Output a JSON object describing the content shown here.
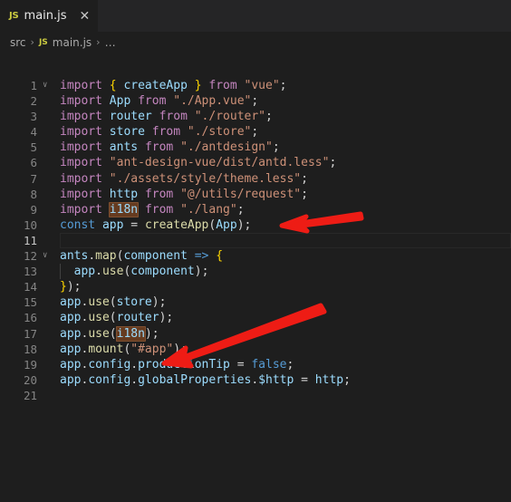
{
  "window": {
    "background": "#1e1e1e",
    "editor_background": "#1e1e1e",
    "tabbar_background": "#252526"
  },
  "tabbar": {
    "tabs": [
      {
        "icon": "js-file-icon",
        "icon_label": "JS",
        "label": "main.js",
        "close_label": "✕",
        "active": true
      }
    ]
  },
  "breadcrumb": {
    "separator": "›",
    "items": [
      {
        "label": "src",
        "icon": null
      },
      {
        "label": "main.js",
        "icon": "js-file-icon",
        "icon_label": "JS"
      },
      {
        "label": "…",
        "icon": null
      }
    ]
  },
  "editor": {
    "active_line": 11,
    "fold_lines": [
      1,
      12
    ],
    "highlight_color": "#653b20",
    "highlight_border_color": "#7f5030",
    "total_lines": 21,
    "lines": [
      {
        "n": "1",
        "tokens": [
          {
            "t": "import",
            "c": "t-kw"
          },
          {
            "t": " ",
            "c": "t-punct"
          },
          {
            "t": "{",
            "c": "t-brace"
          },
          {
            "t": " ",
            "c": "t-punct"
          },
          {
            "t": "createApp",
            "c": "t-var"
          },
          {
            "t": " ",
            "c": "t-punct"
          },
          {
            "t": "}",
            "c": "t-brace"
          },
          {
            "t": " ",
            "c": "t-punct"
          },
          {
            "t": "from",
            "c": "t-kw"
          },
          {
            "t": " ",
            "c": "t-punct"
          },
          {
            "t": "\"vue\"",
            "c": "t-str"
          },
          {
            "t": ";",
            "c": "t-punct"
          }
        ]
      },
      {
        "n": "2",
        "tokens": [
          {
            "t": "import",
            "c": "t-kw"
          },
          {
            "t": " ",
            "c": "t-punct"
          },
          {
            "t": "App",
            "c": "t-var"
          },
          {
            "t": " ",
            "c": "t-punct"
          },
          {
            "t": "from",
            "c": "t-kw"
          },
          {
            "t": " ",
            "c": "t-punct"
          },
          {
            "t": "\"./App.vue\"",
            "c": "t-str"
          },
          {
            "t": ";",
            "c": "t-punct"
          }
        ]
      },
      {
        "n": "3",
        "tokens": [
          {
            "t": "import",
            "c": "t-kw"
          },
          {
            "t": " ",
            "c": "t-punct"
          },
          {
            "t": "router",
            "c": "t-var"
          },
          {
            "t": " ",
            "c": "t-punct"
          },
          {
            "t": "from",
            "c": "t-kw"
          },
          {
            "t": " ",
            "c": "t-punct"
          },
          {
            "t": "\"./router\"",
            "c": "t-str"
          },
          {
            "t": ";",
            "c": "t-punct"
          }
        ]
      },
      {
        "n": "4",
        "tokens": [
          {
            "t": "import",
            "c": "t-kw"
          },
          {
            "t": " ",
            "c": "t-punct"
          },
          {
            "t": "store",
            "c": "t-var"
          },
          {
            "t": " ",
            "c": "t-punct"
          },
          {
            "t": "from",
            "c": "t-kw"
          },
          {
            "t": " ",
            "c": "t-punct"
          },
          {
            "t": "\"./store\"",
            "c": "t-str"
          },
          {
            "t": ";",
            "c": "t-punct"
          }
        ]
      },
      {
        "n": "5",
        "tokens": [
          {
            "t": "import",
            "c": "t-kw"
          },
          {
            "t": " ",
            "c": "t-punct"
          },
          {
            "t": "ants",
            "c": "t-var"
          },
          {
            "t": " ",
            "c": "t-punct"
          },
          {
            "t": "from",
            "c": "t-kw"
          },
          {
            "t": " ",
            "c": "t-punct"
          },
          {
            "t": "\"./antdesign\"",
            "c": "t-str"
          },
          {
            "t": ";",
            "c": "t-punct"
          }
        ]
      },
      {
        "n": "6",
        "tokens": [
          {
            "t": "import",
            "c": "t-kw"
          },
          {
            "t": " ",
            "c": "t-punct"
          },
          {
            "t": "\"ant-design-vue/dist/antd.less\"",
            "c": "t-str"
          },
          {
            "t": ";",
            "c": "t-punct"
          }
        ]
      },
      {
        "n": "7",
        "tokens": [
          {
            "t": "import",
            "c": "t-kw"
          },
          {
            "t": " ",
            "c": "t-punct"
          },
          {
            "t": "\"./assets/style/theme.less\"",
            "c": "t-str"
          },
          {
            "t": ";",
            "c": "t-punct"
          }
        ]
      },
      {
        "n": "8",
        "tokens": [
          {
            "t": "import",
            "c": "t-kw"
          },
          {
            "t": " ",
            "c": "t-punct"
          },
          {
            "t": "http",
            "c": "t-var"
          },
          {
            "t": " ",
            "c": "t-punct"
          },
          {
            "t": "from",
            "c": "t-kw"
          },
          {
            "t": " ",
            "c": "t-punct"
          },
          {
            "t": "\"@/utils/request\"",
            "c": "t-str"
          },
          {
            "t": ";",
            "c": "t-punct"
          }
        ]
      },
      {
        "n": "9",
        "tokens": [
          {
            "t": "import",
            "c": "t-kw"
          },
          {
            "t": " ",
            "c": "t-punct"
          },
          {
            "t": "i18n",
            "c": "t-var",
            "sel": true
          },
          {
            "t": " ",
            "c": "t-punct"
          },
          {
            "t": "from",
            "c": "t-kw"
          },
          {
            "t": " ",
            "c": "t-punct"
          },
          {
            "t": "\"./lang\"",
            "c": "t-str"
          },
          {
            "t": ";",
            "c": "t-punct"
          }
        ]
      },
      {
        "n": "10",
        "tokens": [
          {
            "t": "const",
            "c": "t-ctrl"
          },
          {
            "t": " ",
            "c": "t-punct"
          },
          {
            "t": "app",
            "c": "t-var"
          },
          {
            "t": " ",
            "c": "t-punct"
          },
          {
            "t": "=",
            "c": "t-punct"
          },
          {
            "t": " ",
            "c": "t-punct"
          },
          {
            "t": "createApp",
            "c": "t-fn"
          },
          {
            "t": "(",
            "c": "t-punct"
          },
          {
            "t": "App",
            "c": "t-var"
          },
          {
            "t": ")",
            "c": "t-punct"
          },
          {
            "t": ";",
            "c": "t-punct"
          }
        ]
      },
      {
        "n": "11",
        "tokens": []
      },
      {
        "n": "12",
        "tokens": [
          {
            "t": "ants",
            "c": "t-var"
          },
          {
            "t": ".",
            "c": "t-punct"
          },
          {
            "t": "map",
            "c": "t-fn"
          },
          {
            "t": "(",
            "c": "t-punct"
          },
          {
            "t": "component",
            "c": "t-var"
          },
          {
            "t": " ",
            "c": "t-punct"
          },
          {
            "t": "=>",
            "c": "t-ctrl"
          },
          {
            "t": " ",
            "c": "t-punct"
          },
          {
            "t": "{",
            "c": "t-brace"
          }
        ]
      },
      {
        "n": "13",
        "tokens": [
          {
            "t": "  ",
            "c": "t-punct"
          },
          {
            "t": "app",
            "c": "t-var"
          },
          {
            "t": ".",
            "c": "t-punct"
          },
          {
            "t": "use",
            "c": "t-fn"
          },
          {
            "t": "(",
            "c": "t-punct"
          },
          {
            "t": "component",
            "c": "t-var"
          },
          {
            "t": ")",
            "c": "t-punct"
          },
          {
            "t": ";",
            "c": "t-punct"
          }
        ]
      },
      {
        "n": "14",
        "tokens": [
          {
            "t": "}",
            "c": "t-brace"
          },
          {
            "t": ")",
            "c": "t-punct"
          },
          {
            "t": ";",
            "c": "t-punct"
          }
        ]
      },
      {
        "n": "15",
        "tokens": [
          {
            "t": "app",
            "c": "t-var"
          },
          {
            "t": ".",
            "c": "t-punct"
          },
          {
            "t": "use",
            "c": "t-fn"
          },
          {
            "t": "(",
            "c": "t-punct"
          },
          {
            "t": "store",
            "c": "t-var"
          },
          {
            "t": ")",
            "c": "t-punct"
          },
          {
            "t": ";",
            "c": "t-punct"
          }
        ]
      },
      {
        "n": "16",
        "tokens": [
          {
            "t": "app",
            "c": "t-var"
          },
          {
            "t": ".",
            "c": "t-punct"
          },
          {
            "t": "use",
            "c": "t-fn"
          },
          {
            "t": "(",
            "c": "t-punct"
          },
          {
            "t": "router",
            "c": "t-var"
          },
          {
            "t": ")",
            "c": "t-punct"
          },
          {
            "t": ";",
            "c": "t-punct"
          }
        ]
      },
      {
        "n": "17",
        "tokens": [
          {
            "t": "app",
            "c": "t-var"
          },
          {
            "t": ".",
            "c": "t-punct"
          },
          {
            "t": "use",
            "c": "t-fn"
          },
          {
            "t": "(",
            "c": "t-punct"
          },
          {
            "t": "i18n",
            "c": "t-var",
            "sel": true
          },
          {
            "t": ")",
            "c": "t-punct"
          },
          {
            "t": ";",
            "c": "t-punct"
          }
        ]
      },
      {
        "n": "18",
        "tokens": [
          {
            "t": "app",
            "c": "t-var"
          },
          {
            "t": ".",
            "c": "t-punct"
          },
          {
            "t": "mount",
            "c": "t-fn"
          },
          {
            "t": "(",
            "c": "t-punct"
          },
          {
            "t": "\"#app\"",
            "c": "t-str"
          },
          {
            "t": ")",
            "c": "t-punct"
          },
          {
            "t": ";",
            "c": "t-punct"
          }
        ]
      },
      {
        "n": "19",
        "tokens": [
          {
            "t": "app",
            "c": "t-var"
          },
          {
            "t": ".",
            "c": "t-punct"
          },
          {
            "t": "config",
            "c": "t-var"
          },
          {
            "t": ".",
            "c": "t-punct"
          },
          {
            "t": "productionTip",
            "c": "t-var"
          },
          {
            "t": " ",
            "c": "t-punct"
          },
          {
            "t": "=",
            "c": "t-punct"
          },
          {
            "t": " ",
            "c": "t-punct"
          },
          {
            "t": "false",
            "c": "t-ctrl"
          },
          {
            "t": ";",
            "c": "t-punct"
          }
        ]
      },
      {
        "n": "20",
        "tokens": [
          {
            "t": "app",
            "c": "t-var"
          },
          {
            "t": ".",
            "c": "t-punct"
          },
          {
            "t": "config",
            "c": "t-var"
          },
          {
            "t": ".",
            "c": "t-punct"
          },
          {
            "t": "globalProperties",
            "c": "t-var"
          },
          {
            "t": ".",
            "c": "t-punct"
          },
          {
            "t": "$http",
            "c": "t-var"
          },
          {
            "t": " ",
            "c": "t-punct"
          },
          {
            "t": "=",
            "c": "t-punct"
          },
          {
            "t": " ",
            "c": "t-punct"
          },
          {
            "t": "http",
            "c": "t-var"
          },
          {
            "t": ";",
            "c": "t-punct"
          }
        ]
      },
      {
        "n": "21",
        "tokens": []
      }
    ]
  },
  "annotations": {
    "color": "#ee1c15",
    "arrows": [
      {
        "name": "arrow-to-import-i18n",
        "points_at": "line 9 i18n"
      },
      {
        "name": "arrow-to-app-use-i18n",
        "points_at": "line 17 i18n"
      }
    ]
  }
}
